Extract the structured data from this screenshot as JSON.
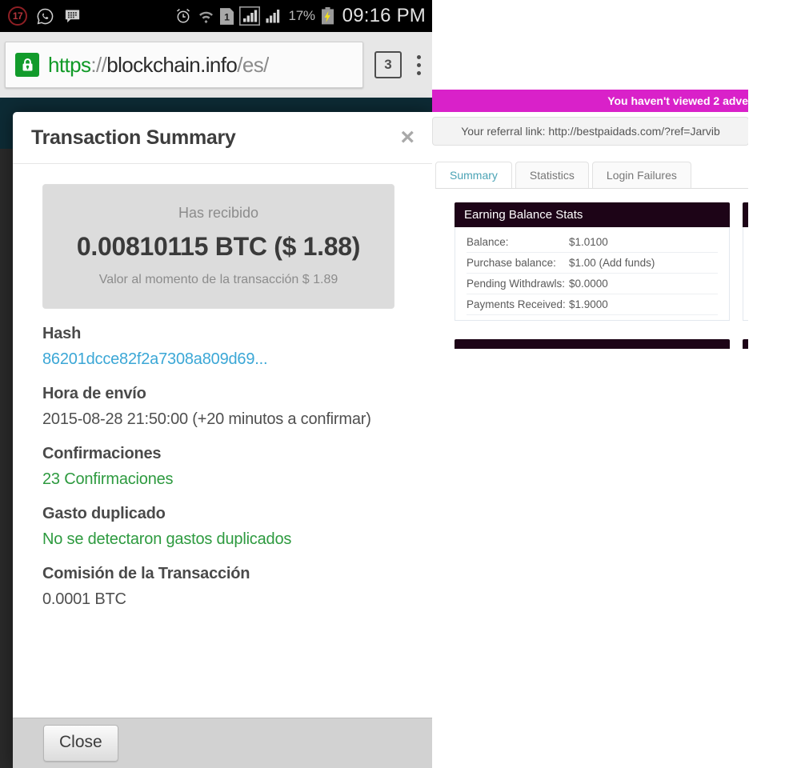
{
  "statusbar": {
    "notification_badge": "17",
    "icons_left": [
      "notification-count-badge",
      "whatsapp-icon",
      "bbm-icon"
    ],
    "icons_right": [
      "alarm-icon",
      "wifi-icon",
      "sim1-icon",
      "signal-icon-1",
      "signal-icon-2",
      "battery-charging-icon"
    ],
    "battery_percent": "17%",
    "clock": "09:16 PM"
  },
  "browser": {
    "lock_icon": "padlock-icon",
    "url_scheme": "https",
    "url_separator": "://",
    "url_host": "blockchain.info",
    "url_path": "/es/",
    "tab_count": "3",
    "menu_icon": "kebab-menu-icon"
  },
  "modal": {
    "title": "Transaction Summary",
    "close_icon": "×",
    "amount": {
      "label": "Has recibido",
      "value": "0.00810115 BTC ($ 1.88)",
      "note": "Valor al momento de la transacción $ 1.89"
    },
    "fields": [
      {
        "label": "Hash",
        "value": "86201dcce82f2a7308a809d69...",
        "style": "link"
      },
      {
        "label": "Hora de envío",
        "value": "2015-08-28 21:50:00 (+20 minutos a confirmar)",
        "style": "plain"
      },
      {
        "label": "Confirmaciones",
        "value": "23 Confirmaciones",
        "style": "green"
      },
      {
        "label": "Gasto duplicado",
        "value": "No se detectaron gastos duplicados",
        "style": "green"
      },
      {
        "label": "Comisión de la Transacción",
        "value": "0.0001 BTC",
        "style": "plain"
      }
    ],
    "close_button": "Close"
  },
  "desktop": {
    "ad_banner": "You haven't viewed 2 adve",
    "referral": "Your referral link: http://bestpaidads.com/?ref=Jarvib",
    "tabs": [
      {
        "label": "Summary",
        "active": true
      },
      {
        "label": "Statistics",
        "active": false
      },
      {
        "label": "Login Failures",
        "active": false
      }
    ],
    "panel": {
      "heading": "Earning Balance Stats",
      "rows": [
        {
          "key": "Balance:",
          "value": "$1.0100"
        },
        {
          "key": "Purchase balance:",
          "value": "$1.00 (Add funds)"
        },
        {
          "key": "Pending Withdrawls:",
          "value": "$0.0000"
        },
        {
          "key": "Payments Received:",
          "value": "$1.9000"
        }
      ]
    }
  },
  "colors": {
    "accent_magenta": "#d921c9",
    "panel_header": "#1d0417",
    "tab_active": "#4ba3b5",
    "link": "#3ba7d6",
    "success": "#2d9a3f",
    "lock_green": "#129b2b",
    "site_header": "#0d2b35"
  }
}
